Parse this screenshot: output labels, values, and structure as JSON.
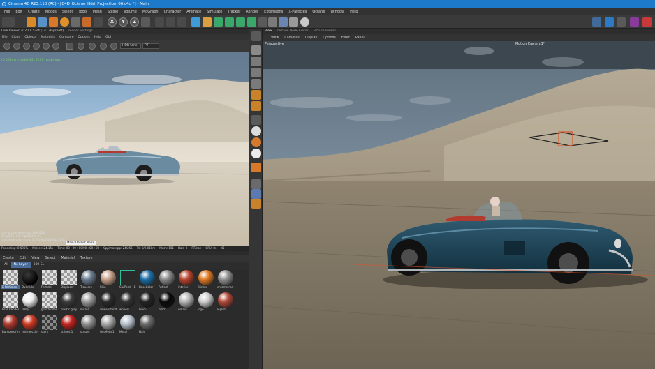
{
  "window": {
    "title": "Cinema 4D R23.110 (RC) - [C4D_Octane_Hdri_Projection_06.c4d *] - Main"
  },
  "menubar": [
    "File",
    "Edit",
    "Create",
    "Modes",
    "Select",
    "Tools",
    "Mesh",
    "Spline",
    "Volume",
    "MoGraph",
    "Character",
    "Animate",
    "Simulate",
    "Tracker",
    "Render",
    "Extensions",
    "X-Particles",
    "Octane",
    "Window",
    "Help"
  ],
  "toolbar": {
    "axes": [
      "X",
      "Y",
      "Z"
    ]
  },
  "live_viewer": {
    "title": "Live Viewer 2020.1.5-R4 (141 days left)",
    "second_tab": "Render Settings",
    "menu": [
      "File",
      "Cloud",
      "Objects",
      "Materials",
      "Compare",
      "Options",
      "Help",
      "GUI"
    ],
    "tonemap": "HDR tone",
    "kernel": "PT",
    "status": "(0.062ms, models[4], [1] 0 rendering...",
    "info_lines": [
      "Out-of-core used/max:0Kb/4Gb",
      "Grey8/16: 0/0       Rgb32/64: 3/3",
      "Used/free/total vram: 3.491Gb/5.449Gb/11Gb"
    ],
    "tooltip": "Main: Default Noise",
    "stats": [
      "Rendering: 0.595%",
      "Ms/sec: 24.15k",
      "Time: 00 : 00 : 00/00 : 00 : 00",
      "Spp/maxspp: 24/256",
      "Tri: 0/2.060m",
      "Mesh: 101",
      "Hair: 0",
      "RTX:on",
      "GPU: 84",
      "45"
    ]
  },
  "materials": {
    "menu": [
      "Create",
      "Edit",
      "View",
      "Select",
      "Material",
      "Texture"
    ],
    "filters": [
      "All",
      "No Layer",
      "300 SL"
    ],
    "active_filter": "No Layer",
    "items": [
      {
        "name": "X-Particles",
        "swatch": "checker",
        "selected": true
      },
      {
        "name": "Override",
        "swatch": "black"
      },
      {
        "name": "Particle",
        "swatch": "checker"
      },
      {
        "name": "Displacer",
        "swatch": "checker"
      },
      {
        "name": "Trousers",
        "swatch": "#6a7d91"
      },
      {
        "name": "Skin",
        "swatch": "#c9a28a"
      },
      {
        "name": "CarPaint - B",
        "swatch": "mix"
      },
      {
        "name": "BaseColor",
        "swatch": "#1c6ea6"
      },
      {
        "name": "Reflect",
        "swatch": "#8a8a8a"
      },
      {
        "name": "interior",
        "swatch": "#b8432c"
      },
      {
        "name": "Blinker",
        "swatch": "#e07a24"
      },
      {
        "name": "chrome rea",
        "swatch": "#909090"
      },
      {
        "name": "Glas Rendel",
        "swatch": "checker"
      },
      {
        "name": "lamp",
        "swatch": "#eeeeee"
      },
      {
        "name": "glas fender",
        "swatch": "checker"
      },
      {
        "name": "plastic grey",
        "swatch": "#3c3c3c"
      },
      {
        "name": "mirror",
        "swatch": "#9a9a9a"
      },
      {
        "name": "wheels fend",
        "swatch": "#2b2b2b"
      },
      {
        "name": "wheels",
        "swatch": "#333333"
      },
      {
        "name": "black",
        "swatch": "#232323"
      },
      {
        "name": "black",
        "swatch": "#0a0a0a"
      },
      {
        "name": "emaul",
        "swatch": "#b5b5b5"
      },
      {
        "name": "logo",
        "swatch": "#cfcfcf"
      },
      {
        "name": "leplch",
        "swatch": "#b24a3a"
      },
      {
        "name": "Bumpers (mi",
        "swatch": "#b23a2e"
      },
      {
        "name": "red rueckle",
        "swatch": "#d13a22"
      },
      {
        "name": "stern",
        "swatch": "checker-dark"
      },
      {
        "name": "stripes.1",
        "swatch": "#c42420"
      },
      {
        "name": "stripes",
        "swatch": "#909090"
      },
      {
        "name": "OctMetal1",
        "swatch": "#a7a7a7"
      },
      {
        "name": "Metal",
        "swatch": "#b8c2cc"
      },
      {
        "name": "Hair",
        "swatch": "#6b6b6b"
      }
    ]
  },
  "viewport": {
    "tabs": [
      "View",
      "Octane Node Editor",
      "Picture Viewer"
    ],
    "menu": [
      "View",
      "Cameras",
      "Display",
      "Options",
      "Filter",
      "Panel"
    ],
    "projection": "Perspective",
    "camera": "Motion Camera1*"
  },
  "colors": {
    "titlebar": "#1d79c9",
    "selection": "#4a6d9a",
    "status_green": "#7dd46a"
  }
}
